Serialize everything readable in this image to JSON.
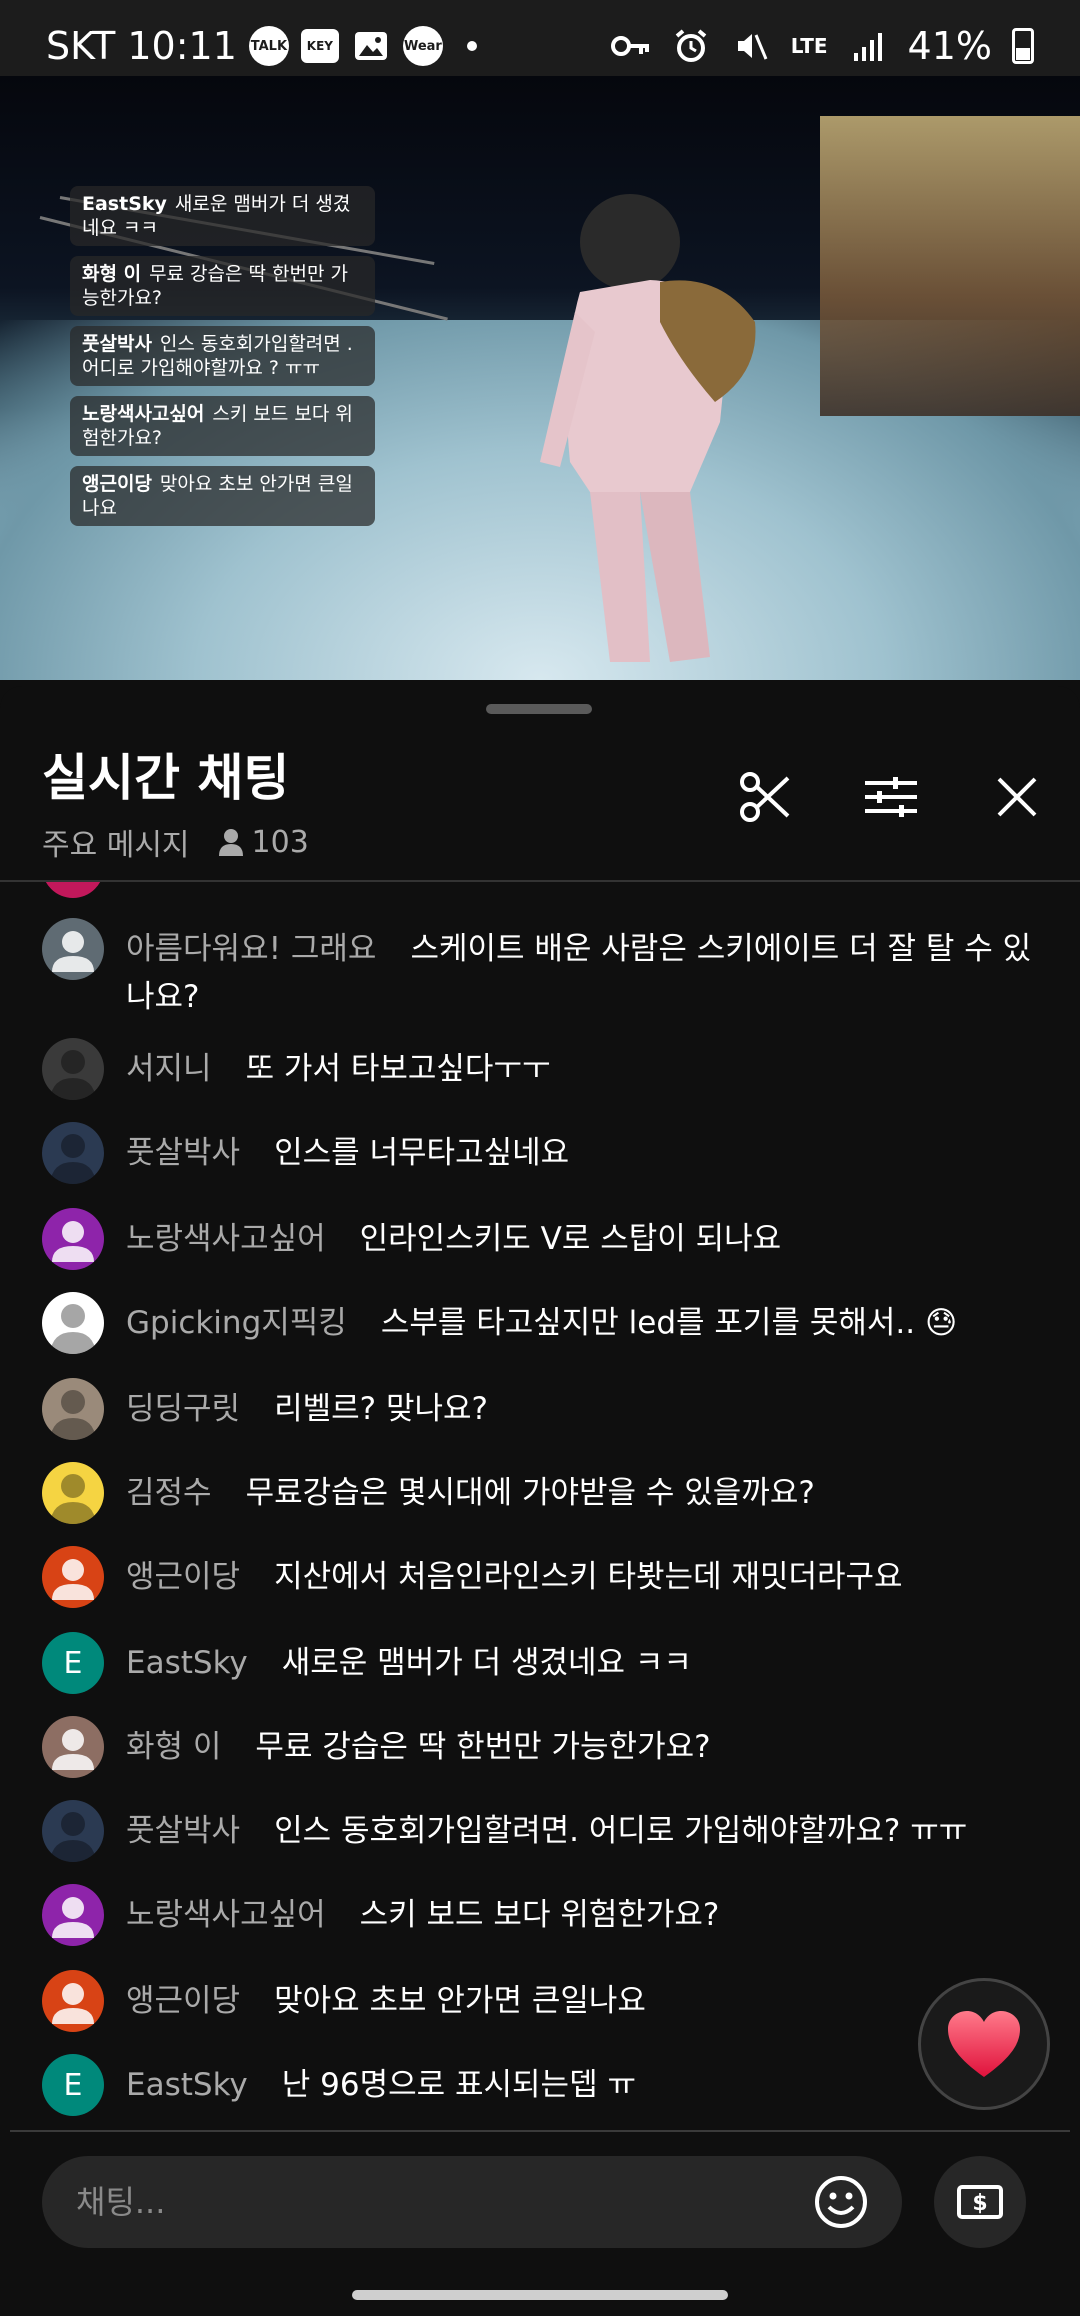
{
  "status": {
    "carrier_time": "SKT 10:11",
    "notifs": [
      "TALK",
      "KEY",
      "Wear"
    ],
    "network": "LTE",
    "battery": "41%"
  },
  "video_overlay": [
    {
      "author": "EastSky",
      "text": "새로운 맴버가 더 생겼네요 ㅋㅋ"
    },
    {
      "author": "화형 이",
      "text": "무료 강습은 딱 한번만 가능한가요?"
    },
    {
      "author": "풋살박사",
      "text": "인스 동호회가입할려면 . 어디로 가입해야할까요 ? ㅠㅠ"
    },
    {
      "author": "노랑색사고싶어",
      "text": "스키 보드 보다 위험한가요?"
    },
    {
      "author": "앵근이당",
      "text": "맞아요 초보 안가면 큰일나요"
    }
  ],
  "chat": {
    "title": "실시간 채팅",
    "filter_label": "주요 메시지",
    "viewer_count": "103"
  },
  "messages": [
    {
      "author": "아름다워요! 그래요",
      "text": "스케이트 배운 사람은 스키에이트 더 잘 탈 수 있나요?",
      "avatar": "default",
      "color": "#5f6b73"
    },
    {
      "author": "서지니",
      "text": "또 가서 타보고싶다ㅜㅜ",
      "avatar": "photo",
      "color": "#3a3a3a"
    },
    {
      "author": "풋살박사",
      "text": "인스를 너무타고싶네요",
      "avatar": "photo",
      "color": "#2b3a52"
    },
    {
      "author": "노랑색사고싶어",
      "text": "인라인스키도 V로 스탑이 되나요",
      "avatar": "default",
      "color": "#8e24aa"
    },
    {
      "author": "Gpicking지픽킹",
      "text": "스부를 타고싶지만 led를 포기를 못해서.. 😓",
      "avatar": "photo",
      "color": "#ffffff"
    },
    {
      "author": "딩딩구릿",
      "text": "리벨르? 맞나요?",
      "avatar": "photo",
      "color": "#9a8a7a"
    },
    {
      "author": "김정수",
      "text": "무료강습은 몇시대에 가야받을 수 있을까요?",
      "avatar": "photo",
      "color": "#f5d442"
    },
    {
      "author": "앵근이당",
      "text": "지산에서 처음인라인스키 타봣는데 재밋더라구요",
      "avatar": "default",
      "color": "#d84315"
    },
    {
      "author": "EastSky",
      "text": "새로운 맴버가 더 생겼네요 ㅋㅋ",
      "avatar": "E",
      "color": "#00897b"
    },
    {
      "author": "화형 이",
      "text": "무료 강습은 딱 한번만 가능한가요?",
      "avatar": "default",
      "color": "#8d6e63"
    },
    {
      "author": "풋살박사",
      "text": "인스 동호회가입할려면. 어디로 가입해야할까요? ㅠㅠ",
      "avatar": "photo",
      "color": "#2b3a52"
    },
    {
      "author": "노랑색사고싶어",
      "text": "스키 보드 보다 위험한가요?",
      "avatar": "default",
      "color": "#8e24aa"
    },
    {
      "author": "앵근이당",
      "text": "맞아요 초보 안가면 큰일나요",
      "avatar": "default",
      "color": "#d84315"
    },
    {
      "author": "EastSky",
      "text": "난 96명으로 표시되는뎁 ㅠ",
      "avatar": "E",
      "color": "#00897b"
    }
  ],
  "input": {
    "placeholder": "채팅..."
  }
}
